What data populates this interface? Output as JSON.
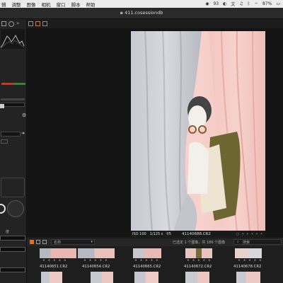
{
  "menubar": {
    "items": [
      "辑",
      "调整",
      "图像",
      "相机",
      "窗口",
      "脚本",
      "帮助"
    ],
    "status_number": "93",
    "battery": "87%"
  },
  "window": {
    "document_title": "411.cosessiondb"
  },
  "left_panel": {
    "label_fragment": "度"
  },
  "viewer": {
    "iso": "ISO 100",
    "shutter": "1/125 s",
    "aperture": "f/5",
    "filename": "41140688.CR2"
  },
  "filmstrip": {
    "sort_label": "名称",
    "selection_info": "已选定 1 个图像，共 186 个图像",
    "search_label": "搜索",
    "row1_labels": [
      "41140651.CR2",
      "41140654.CR2",
      "41140665.CR2",
      "41140672.CR2",
      "41140678.CR2"
    ],
    "stars": "★ ★ ★ ★ ★"
  },
  "colors": {
    "accent": "#e06d2a",
    "background": "#1c1c1c",
    "menubar": "#ececec"
  }
}
